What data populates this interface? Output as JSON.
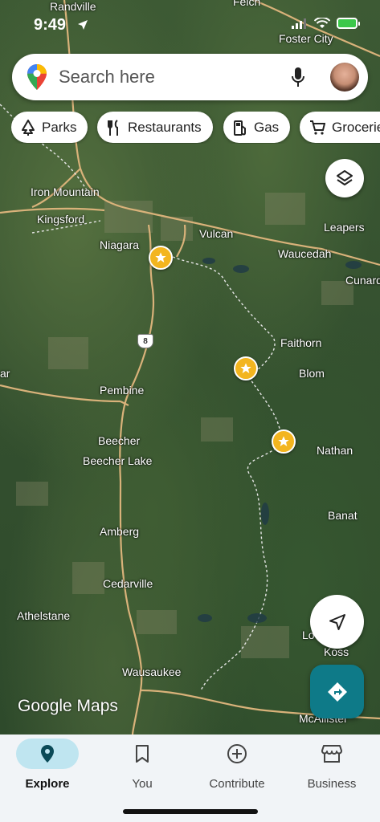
{
  "status_bar": {
    "time": "9:49"
  },
  "search": {
    "placeholder": "Search here"
  },
  "chips": [
    {
      "label": "Parks",
      "icon": "tree-icon"
    },
    {
      "label": "Restaurants",
      "icon": "fork-knife-icon"
    },
    {
      "label": "Gas",
      "icon": "gas-pump-icon"
    },
    {
      "label": "Groceries",
      "icon": "cart-icon"
    }
  ],
  "map": {
    "places": [
      "Randville",
      "Felch",
      "Foster City",
      "Iron Mountain",
      "Kingsford",
      "Niagara",
      "Vulcan",
      "Leapers",
      "Waucedah",
      "Cunard",
      "Faithorn",
      "Blom",
      "Pembine",
      "Beecher",
      "Beecher Lake",
      "Nathan",
      "Banat",
      "Amberg",
      "Cedarville",
      "Athelstane",
      "Wausaukee",
      "Lo",
      "Koss",
      "McAllister",
      "ar"
    ],
    "route_shield": "8",
    "watermark": "Google Maps",
    "marker_color": "#f3b51f"
  },
  "nav": [
    {
      "label": "Explore",
      "icon": "location-pin-icon",
      "active": true
    },
    {
      "label": "You",
      "icon": "bookmark-icon",
      "active": false
    },
    {
      "label": "Contribute",
      "icon": "plus-circle-icon",
      "active": false
    },
    {
      "label": "Business",
      "icon": "storefront-icon",
      "active": false
    }
  ],
  "colors": {
    "accent": "#0e7a88",
    "active_pill": "#bfe5f0"
  }
}
